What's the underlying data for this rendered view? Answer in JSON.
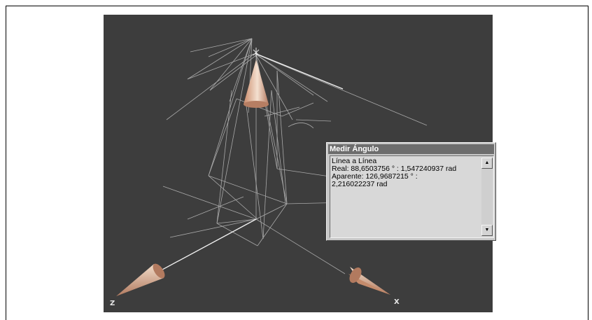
{
  "viewport": {
    "axis_z": "Z",
    "axis_x": "X"
  },
  "measure_panel": {
    "title": "Medir Ángulo",
    "lines": [
      "Línea a Línea",
      "Real:  88,6503756 ° :  1,547240937 rad",
      "Aparente:  126,9687215 ° :",
      "2,216022237 rad"
    ],
    "scroll_up_icon": "▲",
    "scroll_down_icon": "▼"
  }
}
